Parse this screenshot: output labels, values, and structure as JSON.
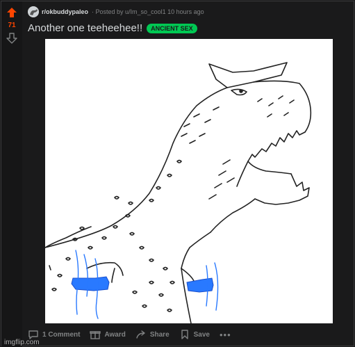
{
  "vote": {
    "score": "71"
  },
  "post": {
    "subreddit": "r/okbuddypaleo",
    "meta": "· Posted by ",
    "author": "u/Im_so_cool1",
    "time": " 10 hours ago",
    "title": "Another one teeheehee!!",
    "flair": "ANCIENT SEX"
  },
  "actions": {
    "comments": "1 Comment",
    "award": "Award",
    "share": "Share",
    "save": "Save",
    "more": "•••"
  },
  "watermark": "imgflip.com",
  "colors": {
    "upvote": "#ff4500",
    "flair": "#00c853",
    "sketch_blue": "#2979ff"
  }
}
